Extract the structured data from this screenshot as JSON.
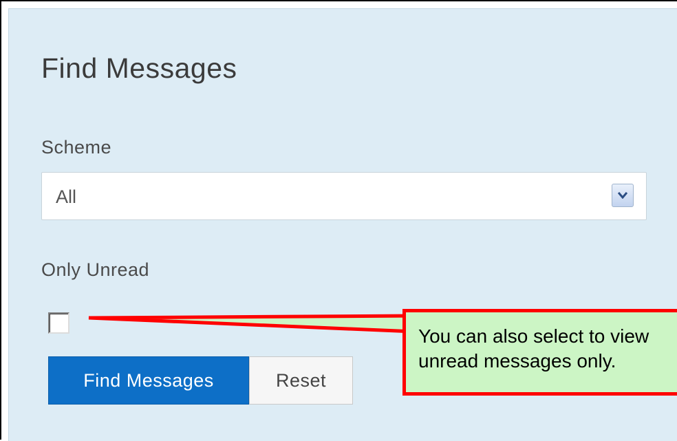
{
  "form": {
    "title": "Find Messages",
    "scheme_label": "Scheme",
    "scheme_selected": "All",
    "only_unread_label": "Only Unread",
    "only_unread_checked": false,
    "find_button_label": "Find Messages",
    "reset_button_label": "Reset"
  },
  "callout": {
    "line1": "You can also select to view",
    "line2": "unread messages only."
  },
  "colors": {
    "panel_background": "#ddecf5",
    "primary_button": "#0d6fc7",
    "callout_border": "#ff0000",
    "callout_fill": "#ccf5c5"
  }
}
